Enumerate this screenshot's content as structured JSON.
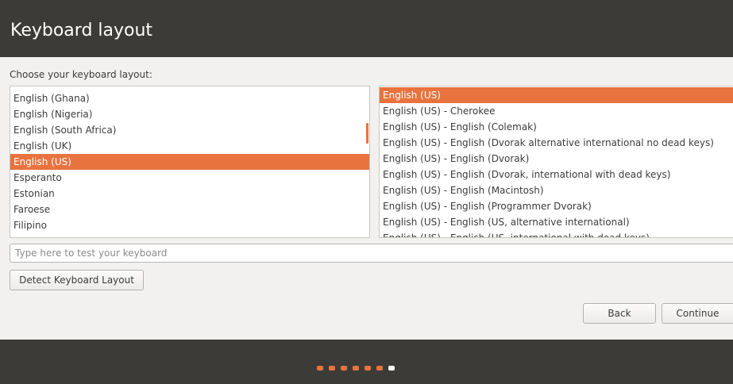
{
  "header": {
    "title": "Keyboard layout"
  },
  "prompt": "Choose your keyboard layout:",
  "layouts": [
    {
      "label": "English (Ghana)"
    },
    {
      "label": "English (Nigeria)"
    },
    {
      "label": "English (South Africa)"
    },
    {
      "label": "English (UK)"
    },
    {
      "label": "English (US)",
      "selected": true
    },
    {
      "label": "Esperanto"
    },
    {
      "label": "Estonian"
    },
    {
      "label": "Faroese"
    },
    {
      "label": "Filipino"
    }
  ],
  "variants": [
    {
      "label": "English (US)",
      "selected": true
    },
    {
      "label": "English (US) - Cherokee"
    },
    {
      "label": "English (US) - English (Colemak)"
    },
    {
      "label": "English (US) - English (Dvorak alternative international no dead keys)"
    },
    {
      "label": "English (US) - English (Dvorak)"
    },
    {
      "label": "English (US) - English (Dvorak, international with dead keys)"
    },
    {
      "label": "English (US) - English (Macintosh)"
    },
    {
      "label": "English (US) - English (Programmer Dvorak)"
    },
    {
      "label": "English (US) - English (US, alternative international)"
    },
    {
      "label": "English (US) - English (US, international with dead keys)"
    }
  ],
  "test_input": {
    "placeholder": "Type here to test your keyboard",
    "value": ""
  },
  "buttons": {
    "detect": "Detect Keyboard Layout",
    "back": "Back",
    "continue": "Continue"
  },
  "progress": {
    "total_steps": 7,
    "current_step": 7
  },
  "colors": {
    "accent": "#e8733e",
    "header_bg": "#3c3b37",
    "content_bg": "#f2f1f0"
  }
}
